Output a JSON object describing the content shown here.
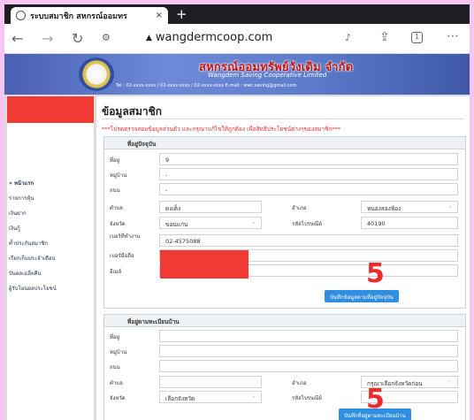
{
  "browser": {
    "tab_title": "ระบบสมาชิก สหกรณ์ออมทร",
    "tab_close": "×",
    "new_tab": "+",
    "url": "wangdermcoop.com",
    "tab_count": "1"
  },
  "banner": {
    "title": "สหกรณ์ออมทรัพย์วังเดิม จำกัด",
    "subtitle": "Wangdem Saving Cooperative Limited",
    "contact": "Tel : 02-xxxx-xxxx / 02-xxxx-xxxx / 02-xxxx-xxxx    E-mail : wwc.saving@gmail.com"
  },
  "sidebar": {
    "items": [
      {
        "label": "» หน้าแรก"
      },
      {
        "label": "รายการหุ้น"
      },
      {
        "label": "เงินฝาก"
      },
      {
        "label": "เงินกู้"
      },
      {
        "label": "ค้ำประกันสมาชิก"
      },
      {
        "label": "เรียกเก็บประจำเดือน"
      },
      {
        "label": "ปันผลเฉลี่ยคืน"
      },
      {
        "label": "ผู้รับโอนผลประโยชน์"
      }
    ]
  },
  "main": {
    "title": "ข้อมูลสมาชิก",
    "notice": "***โปรดตรวจสอบข้อมูลส่วนตัว และกรุณาแก้ไขให้ถูกต้อง เพื่อสิทธิประโยชน์ต่างๆของสมาชิก***",
    "current_address": {
      "header": "ที่อยู่ปัจจุบัน",
      "labels": {
        "house_no": "ที่อยู่",
        "village": "หมู่บ้าน",
        "road": "ถนน",
        "subdistrict": "ตำบล",
        "district": "อำเภอ",
        "province": "จังหวัด",
        "postcode": "รหัสไปรษณีย์",
        "work_phone": "เบอร์ที่ทำงาน",
        "mobile": "เบอร์มือถือ",
        "email": "อีเมล์"
      },
      "values": {
        "house_no": "9",
        "village": "-",
        "road": "-",
        "subdistrict": "ดงเค็ง",
        "district": "หนองสองห้อง",
        "province": "ขอนแก่น",
        "postcode": "40190",
        "work_phone": "02-4575088"
      },
      "save_button": "บันทึกข้อมูลตามที่อยู่ปัจจุบัน",
      "annotation": "5"
    },
    "registered_address": {
      "header": "ที่อยู่ตามทะเบียนบ้าน",
      "labels": {
        "house_no": "ที่อยู่",
        "village": "หมู่บ้าน",
        "road": "ถนน",
        "subdistrict": "ตำบล",
        "district": "อำเภอ",
        "province": "จังหวัด",
        "postcode": "รหัสไปรษณีย์"
      },
      "values": {
        "district": "กรุณาเลือกจังหวัดก่อน",
        "province": "เลือกจังหวัด"
      },
      "save_button": "บันทึกที่อยู่ตามทะเบียนบ้าน",
      "annotation": "5"
    }
  }
}
